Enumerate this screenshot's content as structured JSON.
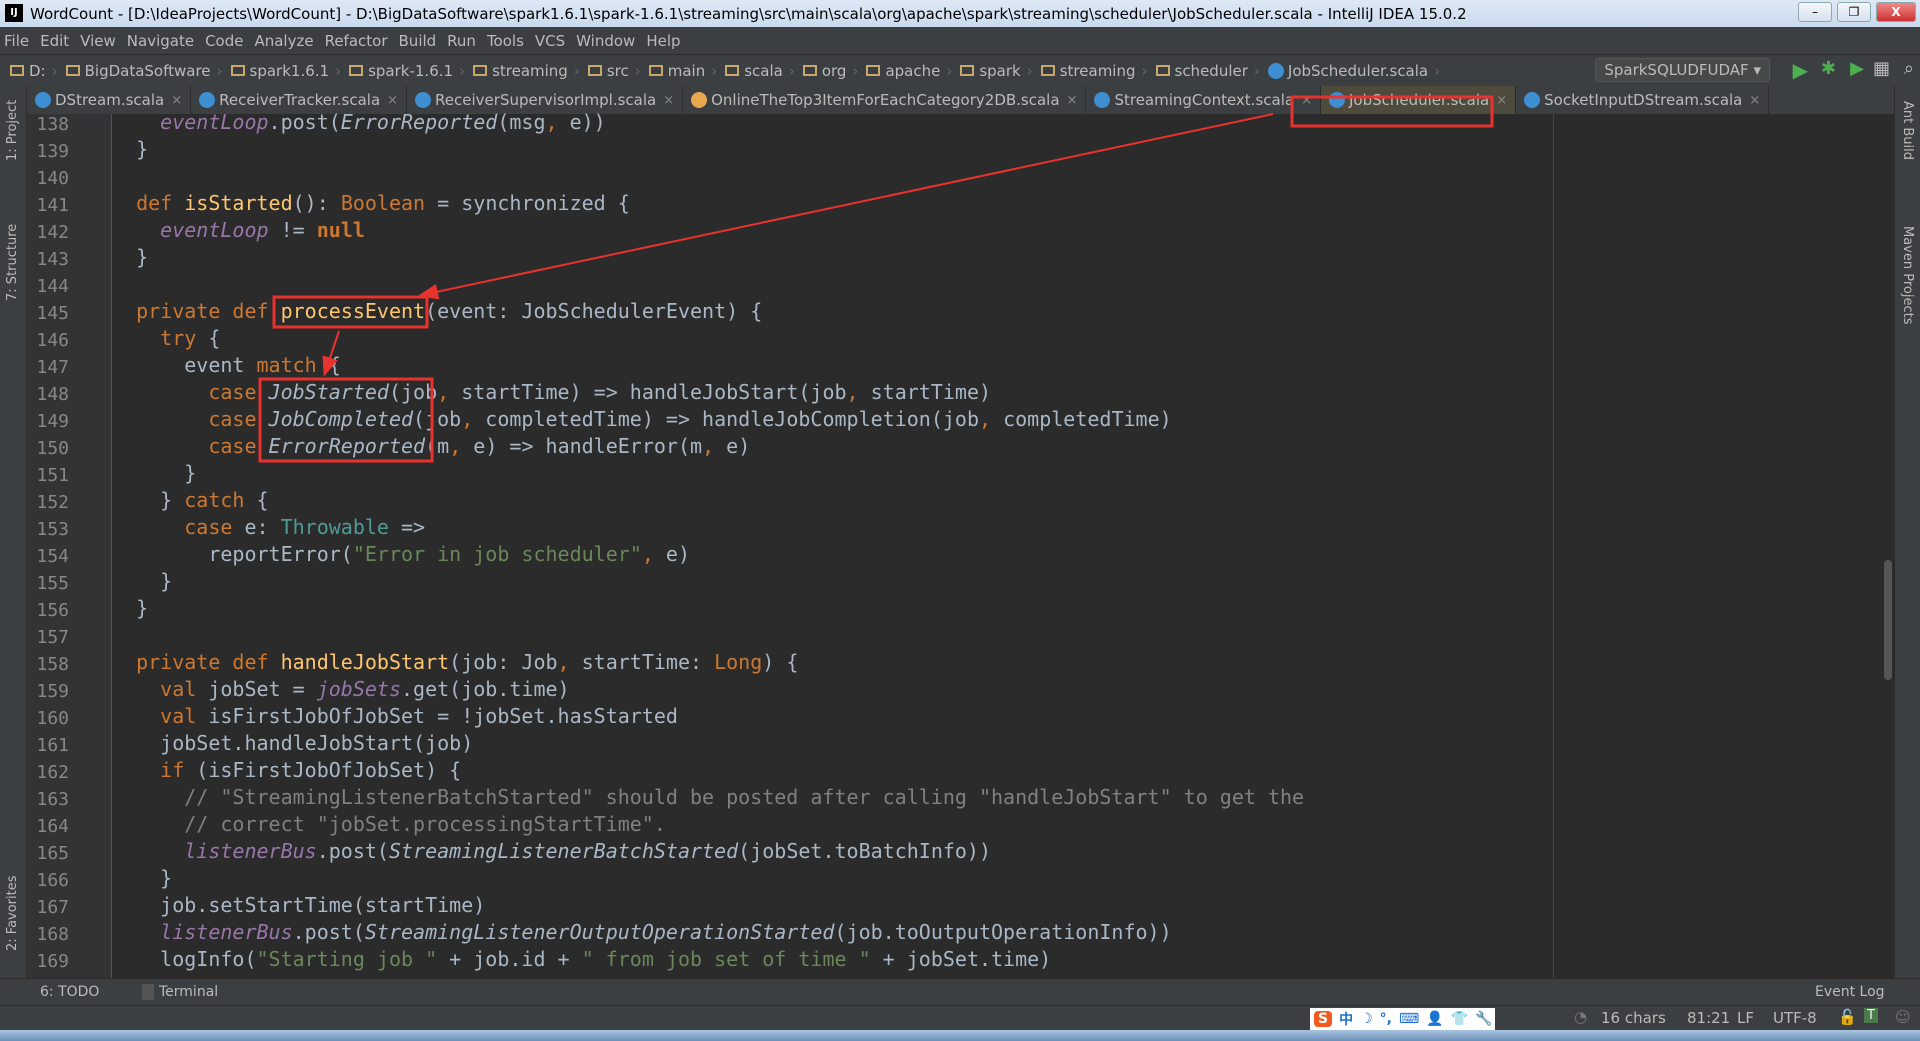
{
  "window": {
    "title": "WordCount - [D:\\IdeaProjects\\WordCount] - D:\\BigDataSoftware\\spark1.6.1\\spark-1.6.1\\streaming\\src\\main\\scala\\org\\apache\\spark\\streaming\\scheduler\\JobScheduler.scala - IntelliJ IDEA 15.0.2",
    "logo": "IJ",
    "minimize": "–",
    "restore": "❐",
    "close": "X"
  },
  "menu": [
    "File",
    "Edit",
    "View",
    "Navigate",
    "Code",
    "Analyze",
    "Refactor",
    "Build",
    "Run",
    "Tools",
    "VCS",
    "Window",
    "Help"
  ],
  "breadcrumb": [
    "D:",
    "BigDataSoftware",
    "spark1.6.1",
    "spark-1.6.1",
    "streaming",
    "src",
    "main",
    "scala",
    "org",
    "apache",
    "spark",
    "streaming",
    "scheduler",
    "JobScheduler.scala"
  ],
  "run_config": "SparkSQLUDFUDAF",
  "tabs": [
    {
      "label": "DStream.scala",
      "icon": "scala-class-icon"
    },
    {
      "label": "ReceiverTracker.scala",
      "icon": "scala-class-icon"
    },
    {
      "label": "ReceiverSupervisorImpl.scala",
      "icon": "scala-class-icon"
    },
    {
      "label": "OnlineTheTop3ItemForEachCategory2DB.scala",
      "icon": "scala-object-icon"
    },
    {
      "label": "StreamingContext.scala",
      "icon": "scala-class-icon"
    },
    {
      "label": "JobScheduler.scala",
      "icon": "scala-class-icon",
      "active": true
    },
    {
      "label": "SocketInputDStream.scala",
      "icon": "scala-class-icon"
    }
  ],
  "left_tools": [
    "1: Project",
    "7: Structure",
    "2: Favorites"
  ],
  "right_tools": [
    "Ant Build",
    "Maven Projects"
  ],
  "colors": {
    "highlight_box": "#e8322e",
    "keyword": "#cc7832",
    "field": "#9876aa",
    "string": "#6a8759",
    "comment": "#808080"
  },
  "code": [
    {
      "n": "138",
      "t": [
        [
          "",
          "    "
        ],
        [
          "f",
          "eventLoop"
        ],
        [
          "",
          ".post("
        ],
        [
          "i",
          "ErrorReported"
        ],
        [
          "",
          "(msg"
        ],
        [
          "k",
          ","
        ],
        [
          "",
          " e))"
        ]
      ]
    },
    {
      "n": "139",
      "t": [
        [
          "",
          "  }"
        ]
      ]
    },
    {
      "n": "140",
      "t": []
    },
    {
      "n": "141",
      "t": [
        [
          "",
          "  "
        ],
        [
          "k",
          "def "
        ],
        [
          "d",
          "isStarted"
        ],
        [
          "",
          "(): "
        ],
        [
          "k",
          "Boolean"
        ],
        [
          "",
          " = synchronized {"
        ]
      ]
    },
    {
      "n": "142",
      "t": [
        [
          "",
          "    "
        ],
        [
          "f",
          "eventLoop"
        ],
        [
          "",
          " != "
        ],
        [
          "kb",
          "null"
        ]
      ]
    },
    {
      "n": "143",
      "t": [
        [
          "",
          "  }"
        ]
      ]
    },
    {
      "n": "144",
      "t": []
    },
    {
      "n": "145",
      "t": [
        [
          "",
          "  "
        ],
        [
          "k",
          "private def "
        ],
        [
          "d",
          "processEvent"
        ],
        [
          "",
          "(event: JobSchedulerEvent) {"
        ]
      ]
    },
    {
      "n": "146",
      "t": [
        [
          "",
          "    "
        ],
        [
          "k",
          "try"
        ],
        [
          "",
          " {"
        ]
      ]
    },
    {
      "n": "147",
      "t": [
        [
          "",
          "      event "
        ],
        [
          "k",
          "match"
        ],
        [
          "",
          " {"
        ]
      ]
    },
    {
      "n": "148",
      "t": [
        [
          "",
          "        "
        ],
        [
          "k",
          "case "
        ],
        [
          "i",
          "JobStarted"
        ],
        [
          "",
          "(job"
        ],
        [
          "k",
          ","
        ],
        [
          "",
          " startTime) => handleJobStart(job"
        ],
        [
          "k",
          ","
        ],
        [
          "",
          " startTime)"
        ]
      ]
    },
    {
      "n": "149",
      "t": [
        [
          "",
          "        "
        ],
        [
          "k",
          "case "
        ],
        [
          "i",
          "JobCompleted"
        ],
        [
          "",
          "(job"
        ],
        [
          "k",
          ","
        ],
        [
          "",
          " completedTime) => handleJobCompletion(job"
        ],
        [
          "k",
          ","
        ],
        [
          "",
          " completedTime)"
        ]
      ]
    },
    {
      "n": "150",
      "t": [
        [
          "",
          "        "
        ],
        [
          "k",
          "case "
        ],
        [
          "i",
          "ErrorReported"
        ],
        [
          "",
          "(m"
        ],
        [
          "k",
          ","
        ],
        [
          "",
          " e) => handleError(m"
        ],
        [
          "k",
          ","
        ],
        [
          "",
          " e)"
        ]
      ]
    },
    {
      "n": "151",
      "t": [
        [
          "",
          "      }"
        ]
      ]
    },
    {
      "n": "152",
      "t": [
        [
          "",
          "    } "
        ],
        [
          "k",
          "catch"
        ],
        [
          "",
          " {"
        ]
      ]
    },
    {
      "n": "153",
      "t": [
        [
          "",
          "      "
        ],
        [
          "k",
          "case "
        ],
        [
          "",
          "e: "
        ],
        [
          "t",
          "Throwable"
        ],
        [
          "",
          " =>"
        ]
      ]
    },
    {
      "n": "154",
      "t": [
        [
          "",
          "        reportError("
        ],
        [
          "s",
          "\"Error in job scheduler\""
        ],
        [
          "k",
          ","
        ],
        [
          "",
          " e)"
        ]
      ]
    },
    {
      "n": "155",
      "t": [
        [
          "",
          "    }"
        ]
      ]
    },
    {
      "n": "156",
      "t": [
        [
          "",
          "  }"
        ]
      ]
    },
    {
      "n": "157",
      "t": []
    },
    {
      "n": "158",
      "t": [
        [
          "",
          "  "
        ],
        [
          "k",
          "private def "
        ],
        [
          "d",
          "handleJobStart"
        ],
        [
          "",
          "(job: Job"
        ],
        [
          "k",
          ","
        ],
        [
          "",
          " startTime: "
        ],
        [
          "k",
          "Long"
        ],
        [
          "",
          ") {"
        ]
      ]
    },
    {
      "n": "159",
      "t": [
        [
          "",
          "    "
        ],
        [
          "k",
          "val "
        ],
        [
          "",
          "jobSet = "
        ],
        [
          "f",
          "jobSets"
        ],
        [
          "",
          ".get(job.time)"
        ]
      ]
    },
    {
      "n": "160",
      "t": [
        [
          "",
          "    "
        ],
        [
          "k",
          "val "
        ],
        [
          "",
          "isFirstJobOfJobSet = !jobSet.hasStarted"
        ]
      ]
    },
    {
      "n": "161",
      "t": [
        [
          "",
          "    jobSet.handleJobStart(job)"
        ]
      ]
    },
    {
      "n": "162",
      "t": [
        [
          "",
          "    "
        ],
        [
          "k",
          "if "
        ],
        [
          "",
          "(isFirstJobOfJobSet) {"
        ]
      ]
    },
    {
      "n": "163",
      "t": [
        [
          "",
          "      "
        ],
        [
          "c",
          "// \"StreamingListenerBatchStarted\" should be posted after calling \"handleJobStart\" to get the"
        ]
      ]
    },
    {
      "n": "164",
      "t": [
        [
          "",
          "      "
        ],
        [
          "c",
          "// correct \"jobSet.processingStartTime\"."
        ]
      ]
    },
    {
      "n": "165",
      "t": [
        [
          "",
          "      "
        ],
        [
          "f",
          "listenerBus"
        ],
        [
          "",
          ".post("
        ],
        [
          "i",
          "StreamingListenerBatchStarted"
        ],
        [
          "",
          "(jobSet.toBatchInfo))"
        ]
      ]
    },
    {
      "n": "166",
      "t": [
        [
          "",
          "    }"
        ]
      ]
    },
    {
      "n": "167",
      "t": [
        [
          "",
          "    job.setStartTime(startTime)"
        ]
      ]
    },
    {
      "n": "168",
      "t": [
        [
          "",
          "    "
        ],
        [
          "f",
          "listenerBus"
        ],
        [
          "",
          ".post("
        ],
        [
          "i",
          "StreamingListenerOutputOperationStarted"
        ],
        [
          "",
          "(job.toOutputOperationInfo))"
        ]
      ]
    },
    {
      "n": "169",
      "t": [
        [
          "",
          "    logInfo("
        ],
        [
          "s",
          "\"Starting job \""
        ],
        [
          "",
          " + job.id + "
        ],
        [
          "s",
          "\" from job set of time \""
        ],
        [
          "",
          " + jobSet.time)"
        ]
      ]
    }
  ],
  "toolbar": {
    "todo": "6: TODO",
    "terminal": "Terminal",
    "event_log": "Event Log"
  },
  "ime": [
    "S",
    "中",
    "☽",
    "°,",
    "⌨",
    "👤",
    "👕",
    "🔧"
  ],
  "status": {
    "chars": "16 chars",
    "position": "81:21",
    "line_sep": "LF",
    "encoding": "UTF-8"
  }
}
